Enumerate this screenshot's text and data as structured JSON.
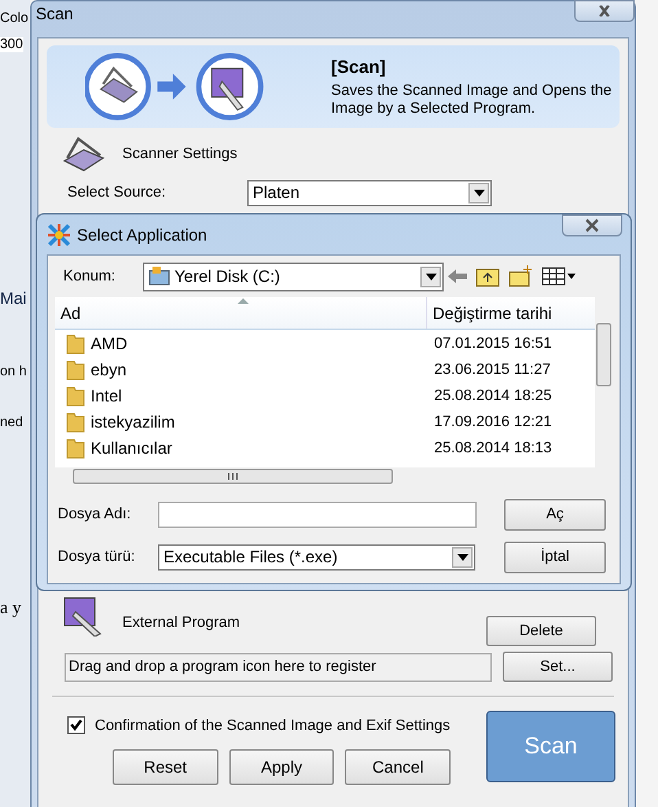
{
  "background_app": {
    "texts": [
      "Colo",
      "300",
      "Mai",
      "on h",
      "ned",
      "a y"
    ]
  },
  "scan_window": {
    "title": "Scan",
    "banner": {
      "heading": "[Scan]",
      "description": "Saves the Scanned Image and Opens the Image by a Selected Program."
    },
    "scanner_settings": {
      "label": "Scanner Settings",
      "source_label": "Select Source:",
      "source_value": "Platen"
    },
    "external_program": {
      "label": "External Program",
      "drop_hint": "Drag and drop a program icon here to register",
      "delete_button": "Delete",
      "set_button": "Set..."
    },
    "confirmation": {
      "label": "Confirmation of the Scanned Image and Exif Settings",
      "checked": true
    },
    "buttons": [
      "Reset",
      "Apply",
      "Cancel"
    ],
    "scan_button": "Scan"
  },
  "select_dialog": {
    "title": "Select Application",
    "location_label": "Konum:",
    "location_value": "Yerel Disk (C:)",
    "columns": [
      "Ad",
      "Değiştirme tarihi"
    ],
    "rows": [
      {
        "name": "AMD",
        "date": "07.01.2015 16:51"
      },
      {
        "name": "ebyn",
        "date": "23.06.2015 11:27"
      },
      {
        "name": "Intel",
        "date": "25.08.2014 18:25"
      },
      {
        "name": "istekyazilim",
        "date": "17.09.2016 12:21"
      },
      {
        "name": "Kullanıcılar",
        "date": "25.08.2014 18:13"
      }
    ],
    "file_name_label": "Dosya Adı:",
    "file_type_label": "Dosya türü:",
    "file_type_value": "Executable Files (*.exe)",
    "open_button": "Aç",
    "cancel_button": "İptal"
  }
}
